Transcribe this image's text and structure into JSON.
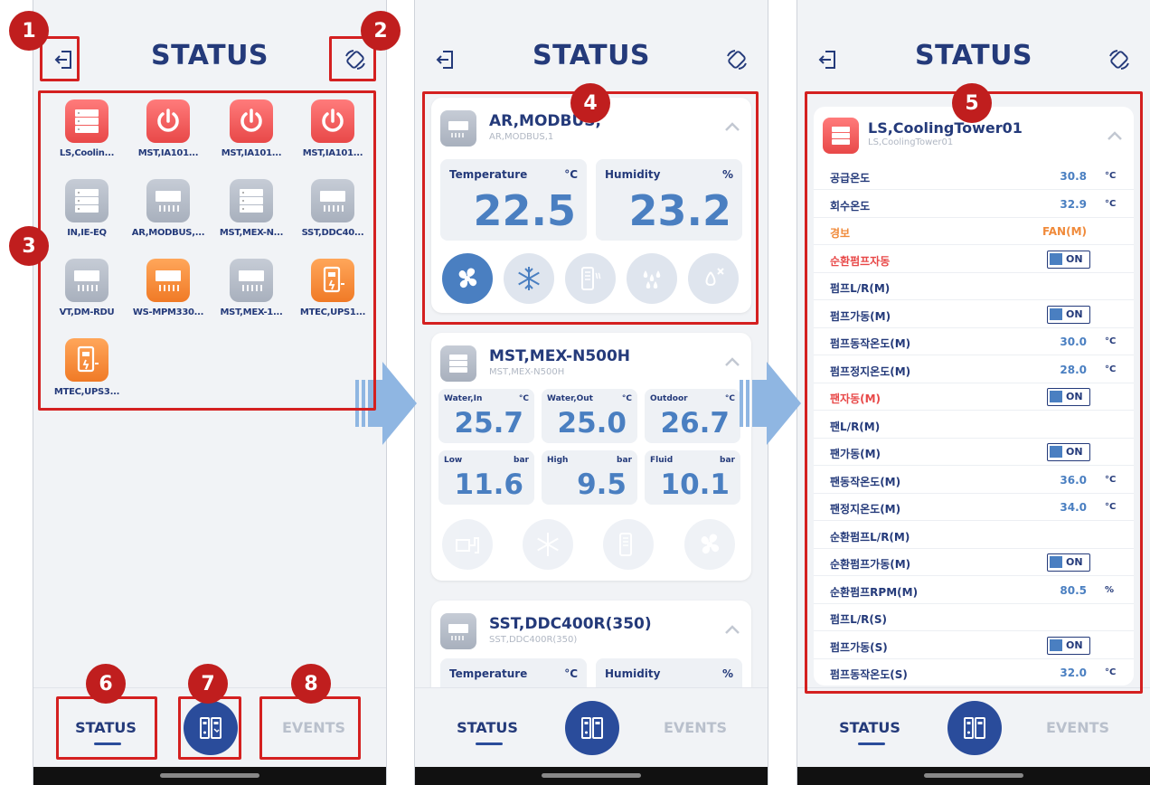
{
  "screens": [
    {
      "title": "STATUS"
    },
    {
      "title": "STATUS"
    },
    {
      "title": "STATUS"
    }
  ],
  "nav": {
    "status_label": "STATUS",
    "events_label": "EVENTS"
  },
  "grid": {
    "tiles": [
      {
        "label": "LS,Coolin...",
        "color": "red",
        "icon": "server-icon"
      },
      {
        "label": "MST,IA101...",
        "color": "red",
        "icon": "power-icon"
      },
      {
        "label": "MST,IA101...",
        "color": "red",
        "icon": "power-icon"
      },
      {
        "label": "MST,IA101...",
        "color": "red",
        "icon": "power-icon"
      },
      {
        "label": "IN,IE-EQ",
        "color": "gray",
        "icon": "server-icon"
      },
      {
        "label": "AR,MODBUS,...",
        "color": "gray",
        "icon": "aircon-icon"
      },
      {
        "label": "MST,MEX-N...",
        "color": "gray",
        "icon": "server-icon"
      },
      {
        "label": "SST,DDC40...",
        "color": "gray",
        "icon": "aircon-icon"
      },
      {
        "label": "VT,DM-RDU",
        "color": "gray",
        "icon": "aircon-icon"
      },
      {
        "label": "WS-MPM330...",
        "color": "orange",
        "icon": "aircon-icon"
      },
      {
        "label": "MST,MEX-1...",
        "color": "gray",
        "icon": "aircon-icon"
      },
      {
        "label": "MTEC,UPS1...",
        "color": "orange",
        "icon": "ups-icon"
      },
      {
        "label": "MTEC,UPS3...",
        "color": "orange",
        "icon": "ups-icon"
      }
    ]
  },
  "card_ar": {
    "name": "AR,MODBUS,",
    "sub": "AR,MODBUS,1",
    "temp_label": "Temperature",
    "temp_unit": "°C",
    "temp_value": "22.5",
    "hum_label": "Humidity",
    "hum_unit": "%",
    "hum_value": "23.2"
  },
  "card_mex": {
    "name": "MST,MEX-N500H",
    "sub": "MST,MEX-N500H",
    "metrics": [
      {
        "label": "Water,In",
        "unit": "°C",
        "value": "25.7"
      },
      {
        "label": "Water,Out",
        "unit": "°C",
        "value": "25.0"
      },
      {
        "label": "Outdoor",
        "unit": "°C",
        "value": "26.7"
      },
      {
        "label": "Low",
        "unit": "bar",
        "value": "11.6"
      },
      {
        "label": "High",
        "unit": "bar",
        "value": "9.5"
      },
      {
        "label": "Fluid",
        "unit": "bar",
        "value": "10.1"
      }
    ]
  },
  "card_sst": {
    "name": "SST,DDC400R(350)",
    "sub": "SST,DDC400R(350)",
    "temp_label": "Temperature",
    "temp_unit": "°C",
    "hum_label": "Humidity",
    "hum_unit": "%"
  },
  "card_ls": {
    "name": "LS,CoolingTower01",
    "sub": "LS,CoolingTower01",
    "rows": [
      {
        "label": "공급온도",
        "value": "30.8",
        "unit": "°C"
      },
      {
        "label": "회수온도",
        "value": "32.9",
        "unit": "°C"
      },
      {
        "label": "경보",
        "value": "FAN(M)",
        "style": "alarm"
      },
      {
        "label": "순환펌프자동",
        "toggle": "ON",
        "style": "warn"
      },
      {
        "label": "펌프L/R(M)"
      },
      {
        "label": "펌프가동(M)",
        "toggle": "ON"
      },
      {
        "label": "펌프동작온도(M)",
        "value": "30.0",
        "unit": "°C"
      },
      {
        "label": "펌프정지온도(M)",
        "value": "28.0",
        "unit": "°C"
      },
      {
        "label": "팬자동(M)",
        "toggle": "ON",
        "style": "warn"
      },
      {
        "label": "팬L/R(M)"
      },
      {
        "label": "팬가동(M)",
        "toggle": "ON"
      },
      {
        "label": "팬동작온도(M)",
        "value": "36.0",
        "unit": "°C"
      },
      {
        "label": "팬정지온도(M)",
        "value": "34.0",
        "unit": "°C"
      },
      {
        "label": "순환펌프L/R(M)"
      },
      {
        "label": "순환펌프가동(M)",
        "toggle": "ON"
      },
      {
        "label": "순환펌프RPM(M)",
        "value": "80.5",
        "unit": "%"
      },
      {
        "label": "펌프L/R(S)"
      },
      {
        "label": "펌프가동(S)",
        "toggle": "ON"
      },
      {
        "label": "펌프동작온도(S)",
        "value": "32.0",
        "unit": "°C"
      }
    ]
  },
  "badges": [
    "1",
    "2",
    "3",
    "4",
    "5",
    "6",
    "7",
    "8"
  ],
  "colors": {
    "accent": "#2a4c9b",
    "title": "#243a7a",
    "value": "#4a7fc1",
    "annotation": "#d42020"
  }
}
